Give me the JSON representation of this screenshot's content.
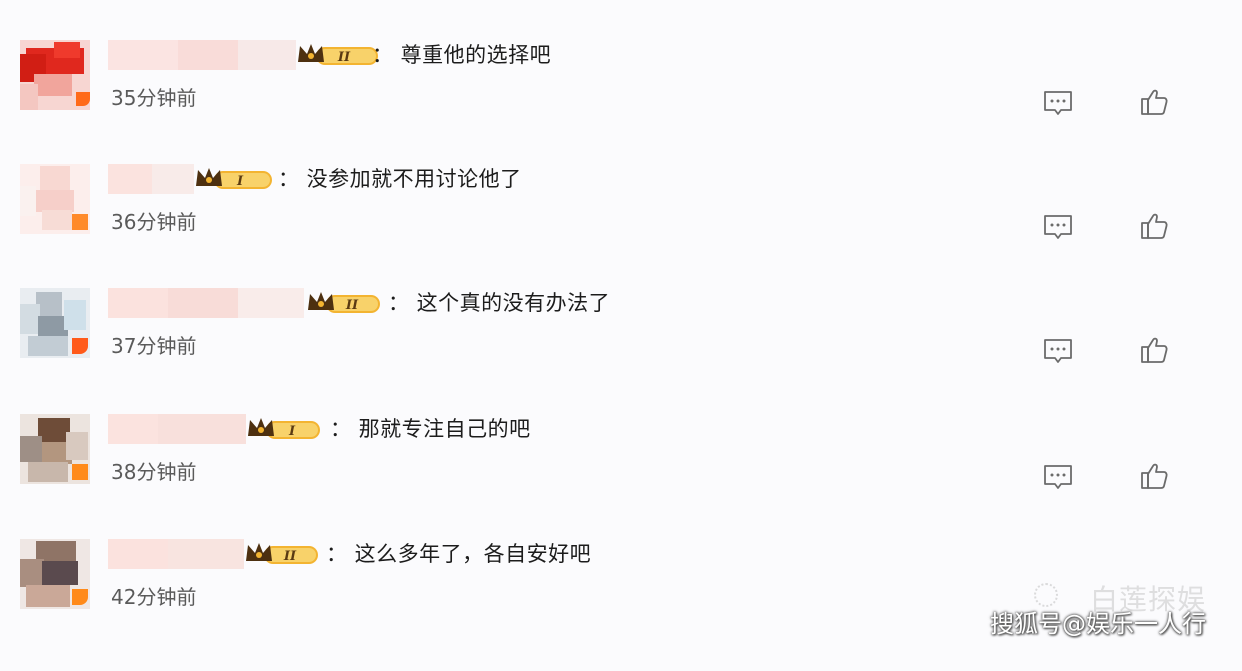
{
  "comments": [
    {
      "text": "：  尊重他的选择吧",
      "time": "35分钟前",
      "level": "II"
    },
    {
      "text": "：  没参加就不用讨论他了",
      "time": "36分钟前",
      "level": "I"
    },
    {
      "text": "：  这个真的没有办法了",
      "time": "37分钟前",
      "level": "II"
    },
    {
      "text": "：  那就专注自己的吧",
      "time": "38分钟前",
      "level": "I"
    },
    {
      "text": "：  这么多年了，各自安好吧",
      "time": "42分钟前",
      "level": "II"
    }
  ],
  "icons": {
    "reply": "comment-icon",
    "like": "thumbs-up-icon",
    "badge": "crown-icon"
  },
  "colors": {
    "badge_gold": "#f3b431",
    "badge_crown": "#5a3a12",
    "avatar_corner": "#ff7a1a",
    "time_text": "#5a5a5a"
  },
  "watermark": {
    "faint": "白莲探娱",
    "main": "搜狐号@娱乐一人行"
  }
}
